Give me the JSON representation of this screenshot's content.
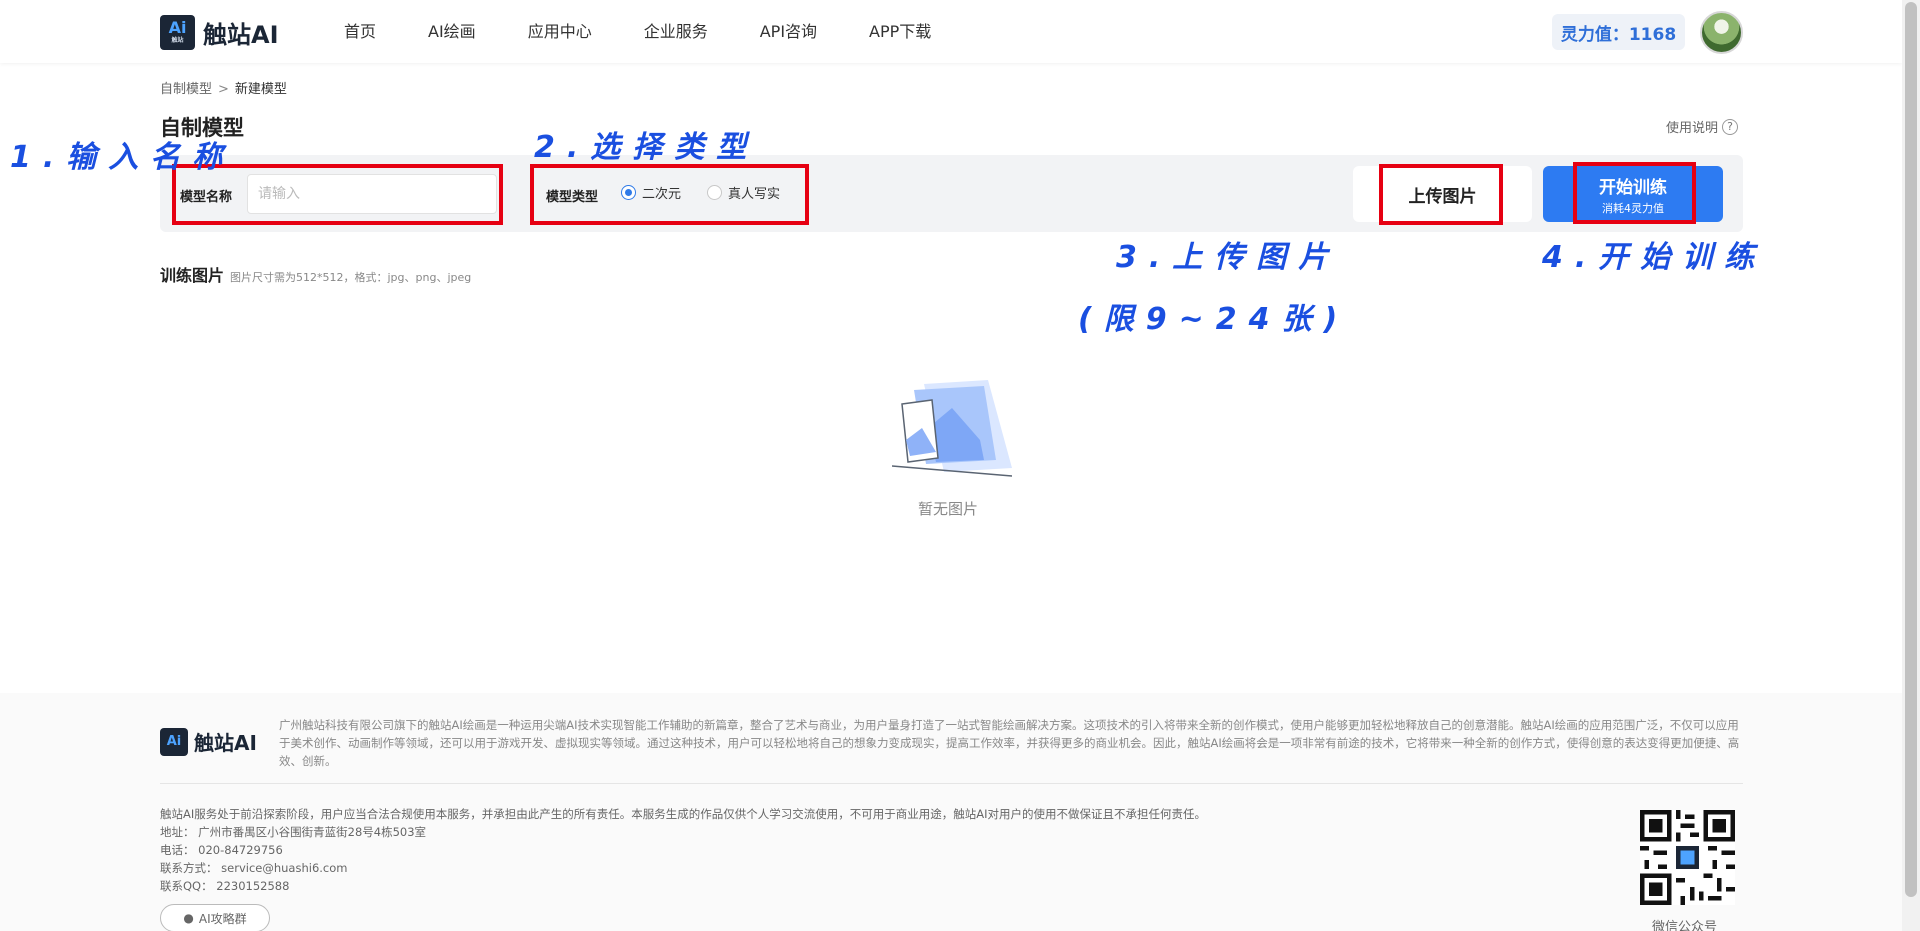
{
  "header": {
    "logo_mark": "Ai",
    "logo_mark_sub": "触站",
    "logo_text": "触站AI",
    "nav": [
      "首页",
      "AI绘画",
      "应用中心",
      "企业服务",
      "API咨询",
      "APP下载"
    ],
    "credits": "灵力值：1168"
  },
  "breadcrumb": {
    "parent": "自制模型",
    "separator": ">",
    "current": "新建模型"
  },
  "page_title": "自制模型",
  "help_link": "使用说明",
  "form": {
    "name_label": "模型名称",
    "name_placeholder": "请输入",
    "type_label": "模型类型",
    "type_options": [
      {
        "label": "二次元",
        "checked": true
      },
      {
        "label": "真人写实",
        "checked": false
      }
    ],
    "upload_button": "上传图片",
    "train_button": "开始训练",
    "train_cost": "消耗4灵力值"
  },
  "annotations": {
    "step1": "1.输入名称",
    "step2": "2.选择类型",
    "step3": "3.上传图片",
    "step3_note": "(限9~24张)",
    "step4": "4.开始训练"
  },
  "training": {
    "title": "训练图片",
    "hint": "图片尺寸需为512*512，格式：jpg、png、jpeg",
    "empty_text": "暂无图片"
  },
  "footer": {
    "logo_text": "触站AI",
    "description": "广州触站科技有限公司旗下的触站AI绘画是一种运用尖端AI技术实现智能工作辅助的新篇章，整合了艺术与商业，为用户量身打造了一站式智能绘画解决方案。这项技术的引入将带来全新的创作模式，使用户能够更加轻松地释放自己的创意潜能。触站AI绘画的应用范围广泛，不仅可以应用于美术创作、动画制作等领域，还可以用于游戏开发、虚拟现实等领域。通过这种技术，用户可以轻松地将自己的想象力变成现实，提高工作效率，并获得更多的商业机会。因此，触站AI绘画将会是一项非常有前途的技术，它将带来一种全新的创作方式，使得创意的表达变得更加便捷、高效、创新。",
    "disclaimer": "触站AI服务处于前沿探索阶段，用户应当合法合规使用本服务，并承担由此产生的所有责任。本服务生成的作品仅供个人学习交流使用，不可用于商业用途，触站AI对用户的使用不做保证且不承担任何责任。",
    "address": "地址：  广州市番禺区小谷围街青蓝街28号4栋503室",
    "phone": "电话：  020-84729756",
    "email": "联系方式：  service@huashi6.com",
    "qq": "联系QQ：  2230152588",
    "group_button": "AI攻略群",
    "qr_label": "微信公众号"
  }
}
